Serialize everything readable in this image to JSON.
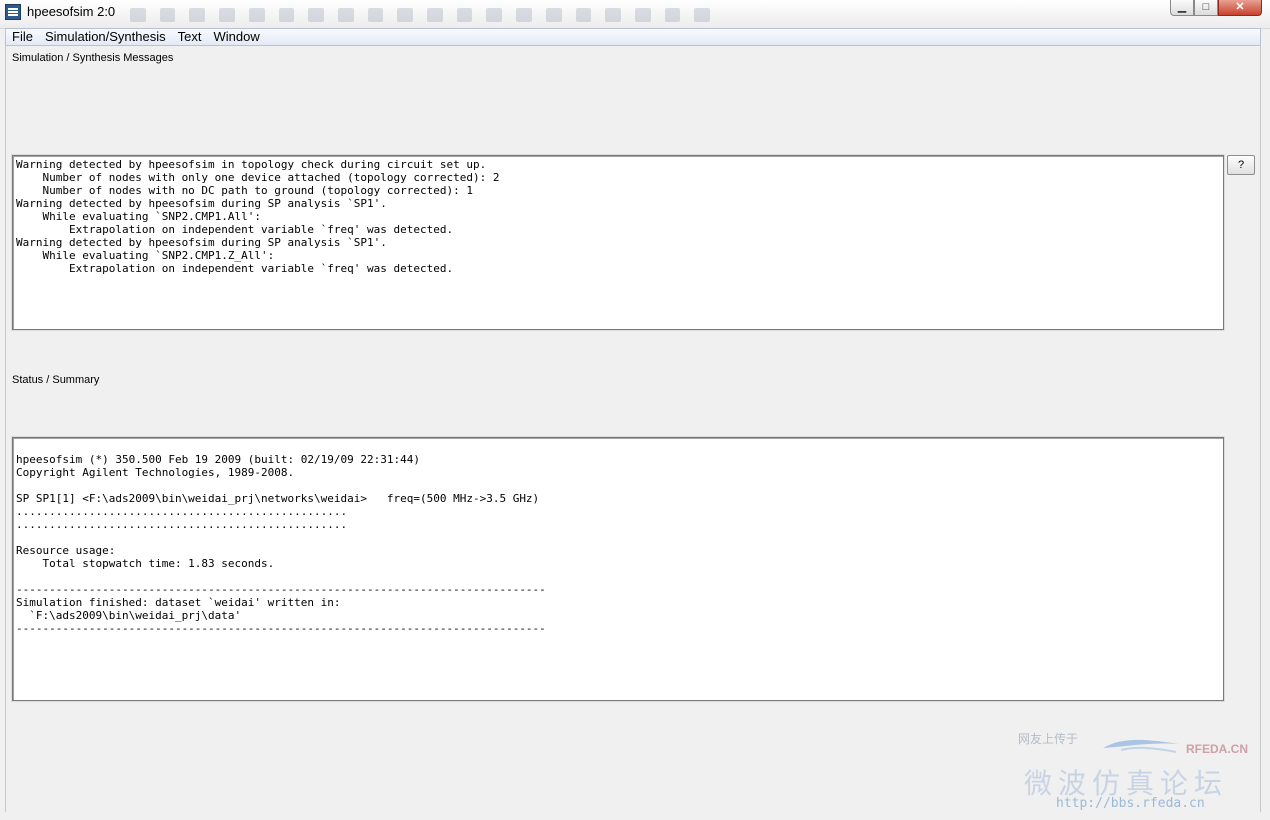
{
  "window": {
    "title": "hpeesofsim 2:0"
  },
  "menu": [
    {
      "label": "File"
    },
    {
      "label": "Simulation/Synthesis"
    },
    {
      "label": "Text"
    },
    {
      "label": "Window"
    }
  ],
  "messages": {
    "label": "Simulation / Synthesis Messages",
    "text": "Warning detected by hpeesofsim in topology check during circuit set up.\n    Number of nodes with only one device attached (topology corrected): 2\n    Number of nodes with no DC path to ground (topology corrected): 1\nWarning detected by hpeesofsim during SP analysis `SP1'.\n    While evaluating `SNP2.CMP1.All':\n        Extrapolation on independent variable `freq' was detected.\nWarning detected by hpeesofsim during SP analysis `SP1'.\n    While evaluating `SNP2.CMP1.Z_All':\n        Extrapolation on independent variable `freq' was detected.",
    "help_label": "?"
  },
  "status": {
    "label": "Status / Summary",
    "text": "\nhpeesofsim (*) 350.500 Feb 19 2009 (built: 02/19/09 22:31:44)\nCopyright Agilent Technologies, 1989-2008.\n\nSP SP1[1] <F:\\ads2009\\bin\\weidai_prj\\networks\\weidai>   freq=(500 MHz->3.5 GHz)\n..................................................\n..................................................\n\nResource usage:\n    Total stopwatch time: 1.83 seconds.\n\n--------------------------------------------------------------------------------\nSimulation finished: dataset `weidai' written in:\n  `F:\\ads2009\\bin\\weidai_prj\\data'\n--------------------------------------------------------------------------------"
  },
  "watermark": {
    "top_text": "网友上传于",
    "brand": "RFEDA.CN",
    "chinese": "微波仿真论坛",
    "url": "http://bbs.rfeda.cn"
  }
}
